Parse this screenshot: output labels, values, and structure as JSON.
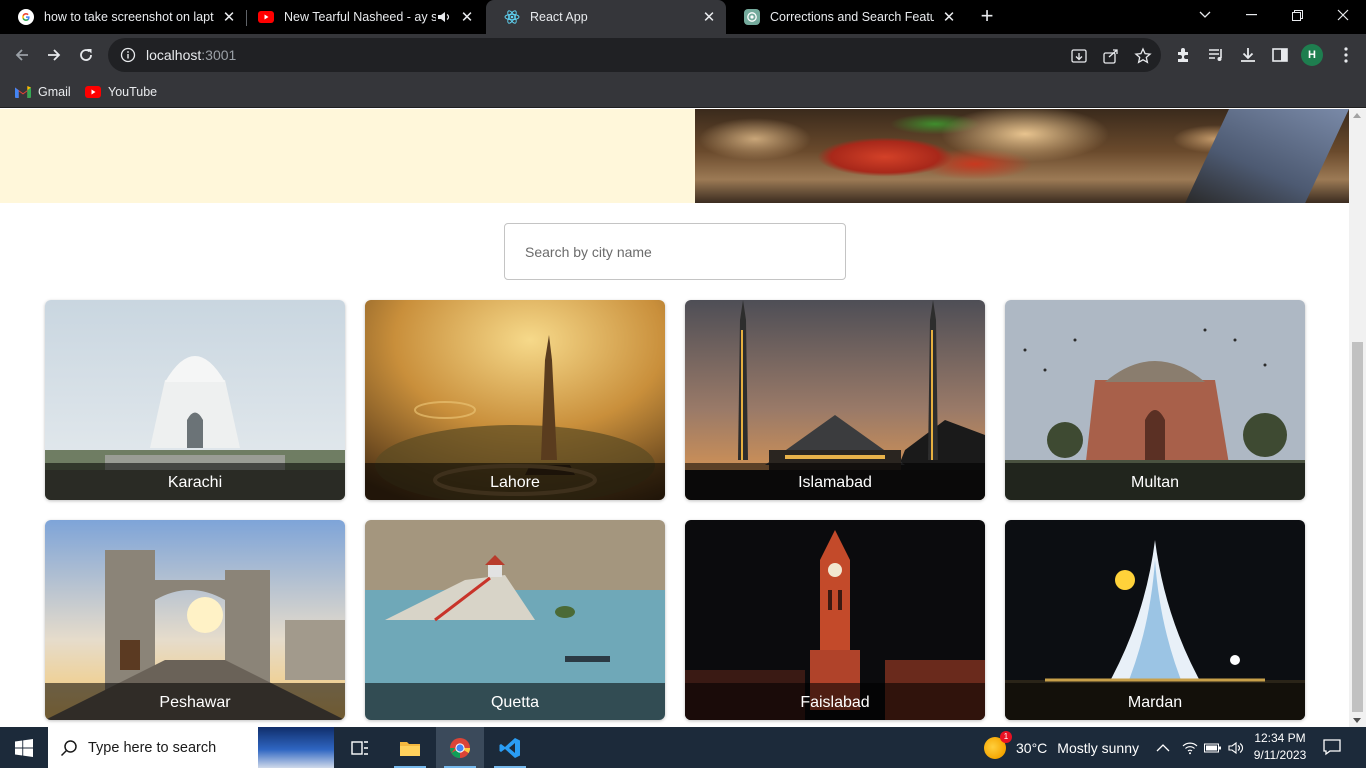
{
  "browser": {
    "tabs": [
      {
        "title": "how to take screenshot on laptop",
        "favicon": "google-icon",
        "muted_icon": false,
        "active": false
      },
      {
        "title": "New Tearful Nasheed - ay shab",
        "favicon": "youtube-icon",
        "muted_icon": true,
        "active": false
      },
      {
        "title": "React App",
        "favicon": "react-icon",
        "muted_icon": false,
        "active": true
      },
      {
        "title": "Corrections and Search Feature",
        "favicon": "chatgpt-icon",
        "muted_icon": false,
        "active": false
      }
    ],
    "url": {
      "host": "localhost",
      "port": ":3001"
    },
    "profile_initial": "H",
    "bookmarks": [
      {
        "label": "Gmail",
        "icon": "gmail-icon"
      },
      {
        "label": "YouTube",
        "icon": "youtube-icon"
      }
    ]
  },
  "page": {
    "search_placeholder": "Search by city name",
    "cities": [
      {
        "name": "Karachi",
        "scene": "mausoleum"
      },
      {
        "name": "Lahore",
        "scene": "minar"
      },
      {
        "name": "Islamabad",
        "scene": "mosque"
      },
      {
        "name": "Multan",
        "scene": "tomb"
      },
      {
        "name": "Peshawar",
        "scene": "gate"
      },
      {
        "name": "Quetta",
        "scene": "lake"
      },
      {
        "name": "Faislabad",
        "scene": "clocktower"
      },
      {
        "name": "Mardan",
        "scene": "monument"
      }
    ]
  },
  "taskbar": {
    "search_placeholder": "Type here to search",
    "weather": {
      "temp": "30°C",
      "condition": "Mostly sunny",
      "badge": "1"
    },
    "time": "12:34 PM",
    "date": "9/11/2023"
  },
  "colors": {
    "tabstrip_bg": "#000000",
    "toolbar_bg": "#35363a",
    "hero_bg": "#fff7da",
    "taskbar_bg": "#1c2a3a"
  }
}
